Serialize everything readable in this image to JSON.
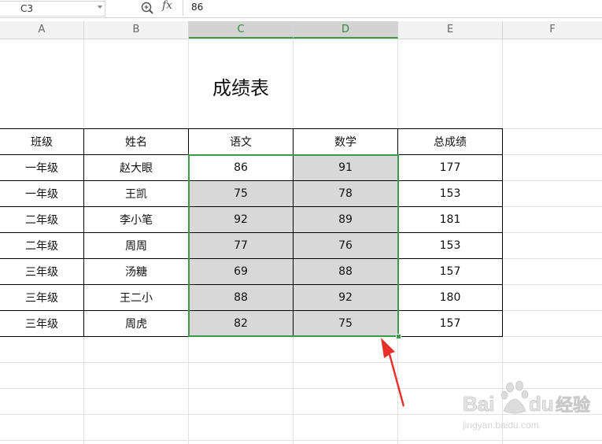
{
  "formula_bar": {
    "cell_ref": "C3",
    "fx_label": "fx",
    "value": "86"
  },
  "columns": [
    "A",
    "B",
    "C",
    "D",
    "E",
    "F"
  ],
  "sheet": {
    "title": "成绩表",
    "headers": [
      "班级",
      "姓名",
      "语文",
      "数学",
      "总成绩"
    ],
    "rows": [
      [
        "一年级",
        "赵大眼",
        "86",
        "91",
        "177"
      ],
      [
        "一年级",
        "王凯",
        "75",
        "78",
        "153"
      ],
      [
        "二年级",
        "李小笔",
        "92",
        "89",
        "181"
      ],
      [
        "二年级",
        "周周",
        "77",
        "76",
        "153"
      ],
      [
        "三年级",
        "汤糖",
        "69",
        "88",
        "157"
      ],
      [
        "三年级",
        "王二小",
        "88",
        "92",
        "180"
      ],
      [
        "三年级",
        "周虎",
        "82",
        "75",
        "157"
      ]
    ]
  },
  "watermark": {
    "brand": "Bai",
    "brand2": "du",
    "cn": "经验",
    "url": "jingyan.baidu.com"
  },
  "colors": {
    "selection": "#3c9a4a",
    "shade": "#d8d8d8",
    "arrow": "#e8302a"
  }
}
